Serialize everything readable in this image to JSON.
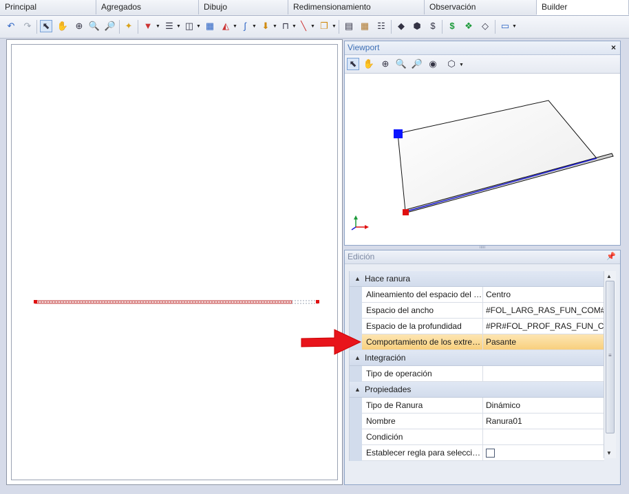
{
  "tabs": [
    {
      "label": "Principal",
      "width": 140
    },
    {
      "label": "Agregados",
      "width": 149
    },
    {
      "label": "Dibujo",
      "width": 130
    },
    {
      "label": "Redimensionamiento",
      "width": 198
    },
    {
      "label": "Observación",
      "width": 163
    },
    {
      "label": "Builder",
      "width": 134
    }
  ],
  "active_tab": "Builder",
  "viewport": {
    "title": "Viewport",
    "close": "×"
  },
  "splitter_grip": "ııııı",
  "edition": {
    "title": "Edición",
    "categories": [
      {
        "name": "Hace ranura",
        "rows": [
          {
            "key": "Alineamiento del espacio del a...",
            "value": "Centro"
          },
          {
            "key": "Espacio del ancho",
            "value": "#FOL_LARG_RAS_FUN_COM#FOL"
          },
          {
            "key": "Espacio de la profundidad",
            "value": "#PR#FOL_PROF_RAS_FUN_COM#"
          },
          {
            "key": "Comportamiento de los extrem...",
            "value": "Pasante"
          }
        ]
      },
      {
        "name": "Integración",
        "rows": [
          {
            "key": "Tipo de operación",
            "value": ""
          }
        ]
      },
      {
        "name": "Propiedades",
        "rows": [
          {
            "key": "Tipo de Ranura",
            "value": "Dinámico"
          },
          {
            "key": "Nombre",
            "value": "Ranura01"
          },
          {
            "key": "Condición",
            "value": ""
          },
          {
            "key": "Establecer regla para selecciona...",
            "value": ""
          }
        ]
      }
    ]
  },
  "colors": {
    "accent": "#3d6fb5",
    "highlight": "#f8cf7d",
    "arrow": "#e8141b",
    "marker_red": "#e01010",
    "marker_blue": "#0a14ff"
  }
}
